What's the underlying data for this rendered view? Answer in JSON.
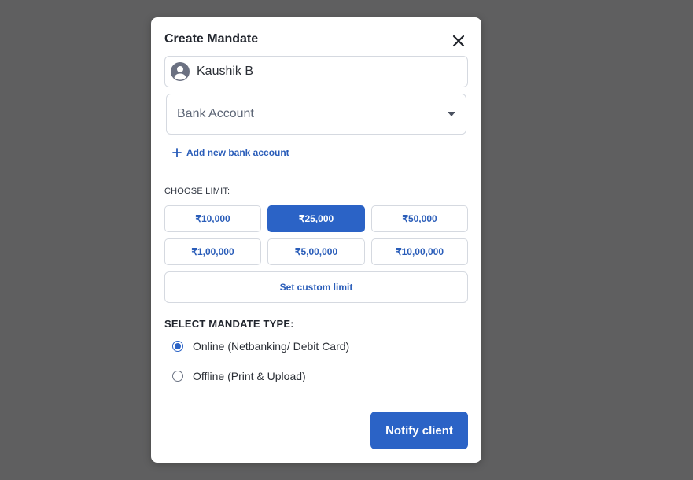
{
  "modal": {
    "title": "Create Mandate",
    "close_icon": "close-icon"
  },
  "client": {
    "name": "Kaushik B",
    "avatar_icon": "user-avatar-icon"
  },
  "bank_account": {
    "placeholder": "Bank Account",
    "caret_icon": "caret-down-icon"
  },
  "add_bank": {
    "label": "Add new bank account",
    "icon": "plus-icon"
  },
  "limits": {
    "label": "CHOOSE LIMIT:",
    "options": [
      "₹10,000",
      "₹25,000",
      "₹50,000",
      "₹1,00,000",
      "₹5,00,000",
      "₹10,00,000"
    ],
    "selected": "₹25,000",
    "custom_label": "Set custom limit"
  },
  "mandate_type": {
    "label": "SELECT MANDATE TYPE:",
    "options": [
      {
        "label": "Online (Netbanking/ Debit Card)",
        "checked": true
      },
      {
        "label": "Offline (Print & Upload)",
        "checked": false
      }
    ]
  },
  "actions": {
    "notify_label": "Notify client"
  },
  "colors": {
    "accent": "#2b63c6",
    "link": "#2a5db9",
    "overlay": "#5f5f60"
  }
}
